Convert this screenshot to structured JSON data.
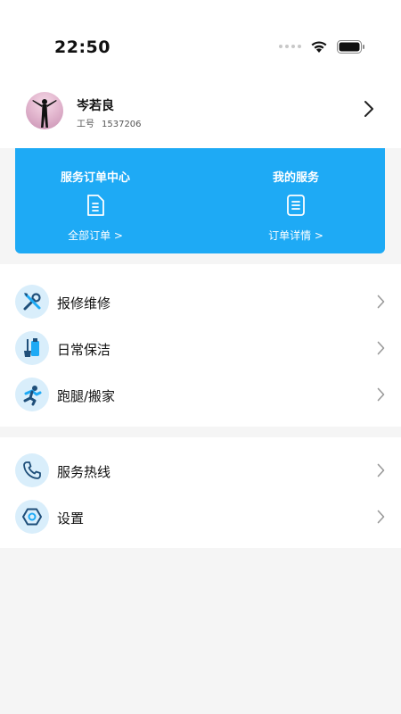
{
  "status": {
    "time": "22:50"
  },
  "profile": {
    "name": "岑若良",
    "id_label": "工号",
    "id_value": "1537206"
  },
  "card": {
    "left": {
      "title": "服务订单中心",
      "link": "全部订单 >"
    },
    "right": {
      "title": "我的服务",
      "link": "订单详情 >"
    }
  },
  "menu_group1": [
    {
      "label": "报修维修",
      "icon": "tools-icon"
    },
    {
      "label": "日常保洁",
      "icon": "cleaning-icon"
    },
    {
      "label": "跑腿/搬家",
      "icon": "runner-icon"
    }
  ],
  "menu_group2": [
    {
      "label": "服务热线",
      "icon": "phone-icon"
    },
    {
      "label": "设置",
      "icon": "settings-icon"
    }
  ],
  "colors": {
    "accent": "#1eaaf5",
    "icon_bg": "#d9eefb",
    "page_bg": "#f5f5f5"
  }
}
